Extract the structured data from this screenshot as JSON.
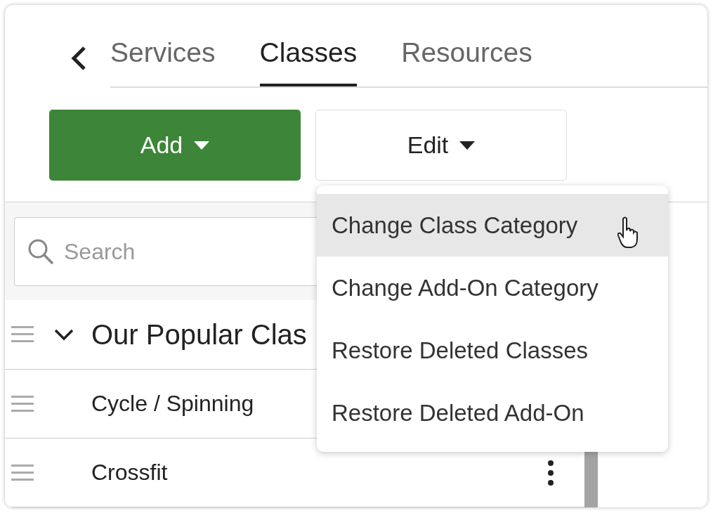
{
  "tabs": [
    {
      "label": "Services",
      "selected": false
    },
    {
      "label": "Classes",
      "selected": true
    },
    {
      "label": "Resources",
      "selected": false
    }
  ],
  "buttons": [
    {
      "label": "Add",
      "kind": "primary"
    },
    {
      "label": "Edit",
      "kind": "secondary"
    }
  ],
  "search": {
    "placeholder": "Search"
  },
  "groups": [
    {
      "title": "Our Popular Clas",
      "expanded": true,
      "children": [
        {
          "name": "Cycle / Spinning"
        },
        {
          "name": "Crossfit"
        }
      ]
    }
  ],
  "menu": {
    "items": [
      {
        "label": "Change Class Category",
        "selected": true
      },
      {
        "label": "Change Add-On Category",
        "selected": false
      },
      {
        "label": "Restore Deleted Classes",
        "selected": false
      },
      {
        "label": "Restore Deleted Add-On",
        "selected": false
      }
    ]
  }
}
